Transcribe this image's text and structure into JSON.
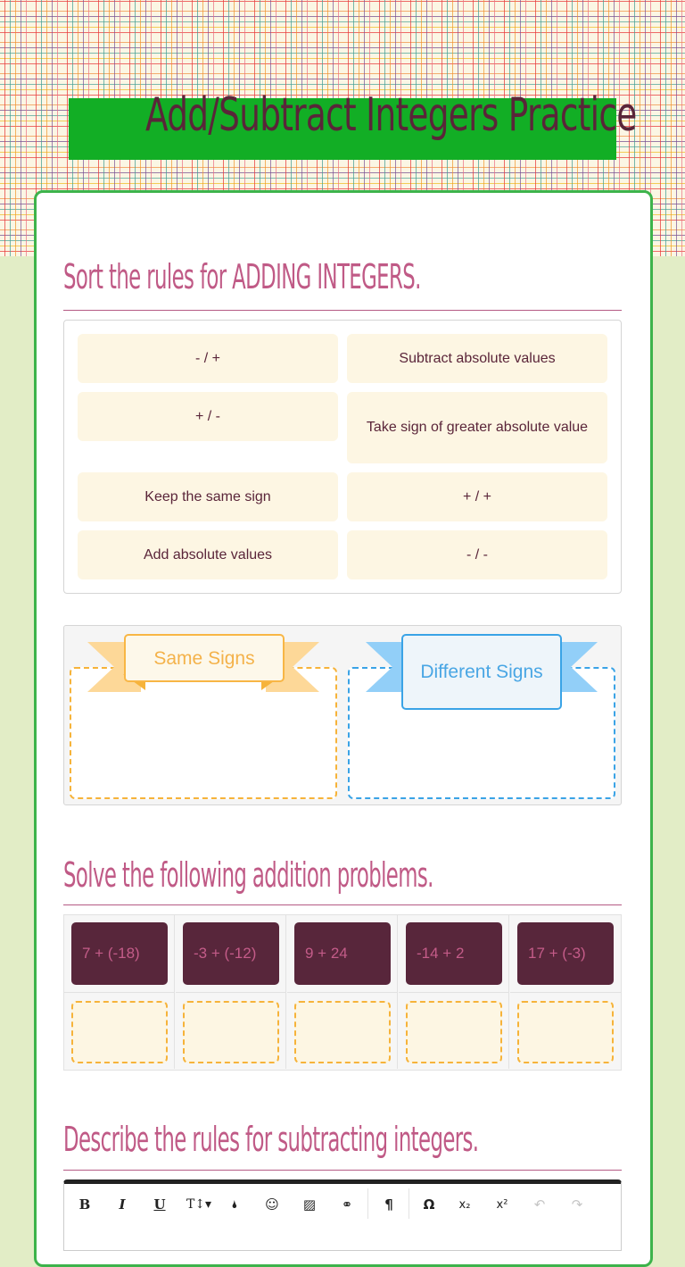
{
  "page": {
    "title": "Add/Subtract Integers Practice"
  },
  "section1": {
    "heading": "Sort the rules for ADDING INTEGERS.",
    "tiles": [
      {
        "label": "- / +"
      },
      {
        "label": "Subtract absolute values"
      },
      {
        "label": "+ / -"
      },
      {
        "label": "Take sign of greater absolute value"
      },
      {
        "label": "Keep the same sign"
      },
      {
        "label": "+ / +"
      },
      {
        "label": "Add absolute values"
      },
      {
        "label": "- / -"
      }
    ],
    "bins": [
      {
        "label": "Same Signs",
        "color": "#f6b33a"
      },
      {
        "label": "Different Signs",
        "color": "#3aa3e6"
      }
    ]
  },
  "section2": {
    "heading": "Solve the following addition problems.",
    "problems": [
      {
        "expr": "7 + (-18)",
        "answer": ""
      },
      {
        "expr": "-3 + (-12)",
        "answer": ""
      },
      {
        "expr": "9 + 24",
        "answer": ""
      },
      {
        "expr": "-14 + 2",
        "answer": ""
      },
      {
        "expr": "17 + (-3)",
        "answer": ""
      }
    ]
  },
  "section3": {
    "heading": "Describe the rules for subtracting integers.",
    "toolbar": [
      {
        "name": "bold",
        "glyph": "B"
      },
      {
        "name": "italic",
        "glyph": "I"
      },
      {
        "name": "underline",
        "glyph": "U"
      },
      {
        "name": "font-size",
        "glyph": "T↕▾"
      },
      {
        "name": "text-color",
        "glyph": "🌢"
      },
      {
        "name": "emoji",
        "glyph": "☺"
      },
      {
        "name": "image",
        "glyph": "▨"
      },
      {
        "name": "link",
        "glyph": "⚭"
      },
      {
        "name": "paragraph-direction",
        "glyph": "¶"
      },
      {
        "name": "special-character",
        "glyph": "Ω"
      },
      {
        "name": "subscript",
        "glyph": "x₂"
      },
      {
        "name": "superscript",
        "glyph": "x²"
      },
      {
        "name": "undo",
        "glyph": "↶"
      },
      {
        "name": "redo",
        "glyph": "↷"
      }
    ]
  },
  "colors": {
    "accent": "#c05a86",
    "header_green": "#12ae25",
    "card_border": "#3db34b",
    "problem_bg": "#58263b"
  }
}
